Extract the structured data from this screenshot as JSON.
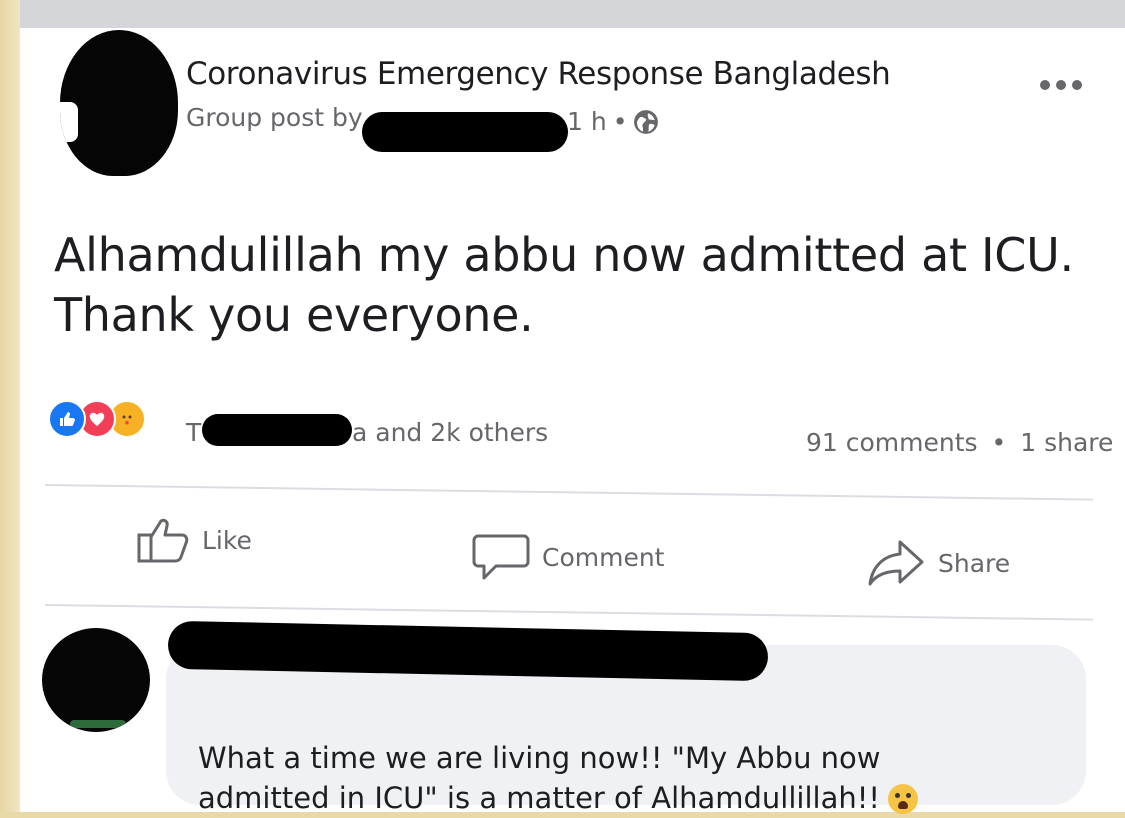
{
  "post": {
    "group_name": "Coronavirus Emergency Response Bangladesh",
    "byline": "Group post by",
    "time": "1 h",
    "dot": "•",
    "body": "Alhamdulillah my abbu now admitted at ICU.\nThank you everyone.",
    "icons": {
      "more": "more-options-icon",
      "audience": "globe-icon"
    }
  },
  "reactions": {
    "icons": [
      "like-reaction-icon",
      "love-reaction-icon",
      "care-reaction-icon"
    ],
    "lead_char": "T",
    "summary_tail": "a and 2k others",
    "comments": "91 comments",
    "separator": "•",
    "shares": "1 share"
  },
  "actions": {
    "like": "Like",
    "comment": "Comment",
    "share": "Share"
  },
  "comment": {
    "text": "What a time we are living now!! \"My Abbu now\nadmitted in ICU\" is a matter of Alhamdullillah!!",
    "emoji": "crying-face-emoji"
  },
  "colors": {
    "text_primary": "#1c1e21",
    "text_secondary": "#65676b",
    "like_blue": "#1877f2",
    "love_red": "#f33e58",
    "bubble_bg": "#eff1f4"
  }
}
